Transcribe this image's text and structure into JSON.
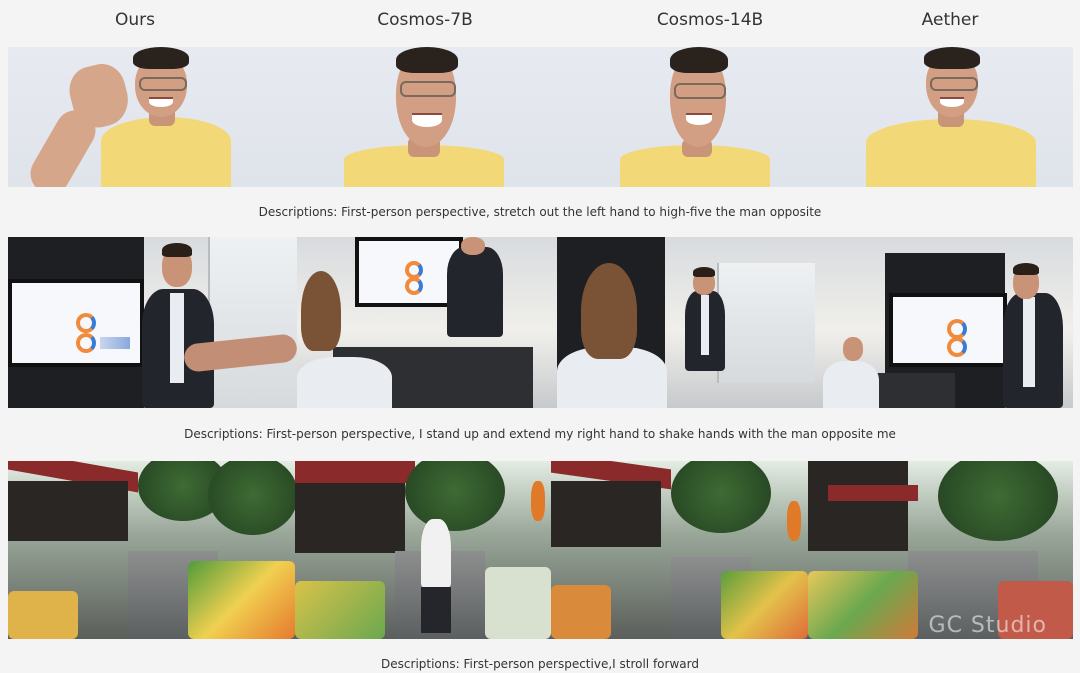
{
  "columns": [
    "Ours",
    "Cosmos-7B",
    "Cosmos-14B",
    "Aether"
  ],
  "rows": [
    {
      "description": "Descriptions: First-person perspective, stretch out the left hand to high-five the man opposite"
    },
    {
      "description": "Descriptions: First-person perspective, I stand up and extend my right hand to shake hands with the man opposite me"
    },
    {
      "description": "Descriptions: First-person perspective,I stroll forward"
    }
  ],
  "watermark": "GC Studio"
}
